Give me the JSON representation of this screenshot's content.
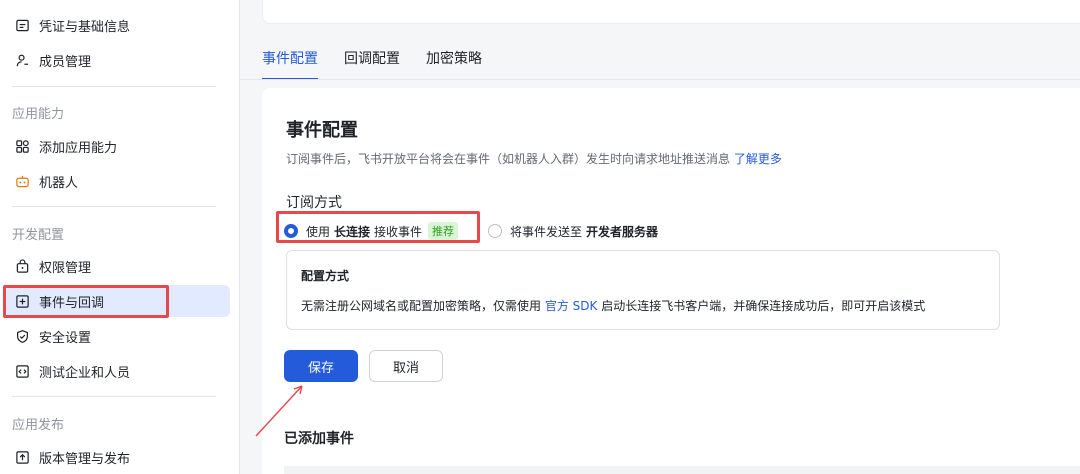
{
  "sidebar": {
    "items": [
      {
        "label": "凭证与基础信息",
        "icon": "credential-icon"
      },
      {
        "label": "成员管理",
        "icon": "member-icon"
      },
      {
        "label": "添加应用能力",
        "icon": "app-grid-icon"
      },
      {
        "label": "机器人",
        "icon": "robot-icon"
      },
      {
        "label": "权限管理",
        "icon": "permission-icon"
      },
      {
        "label": "事件与回调",
        "icon": "event-icon"
      },
      {
        "label": "安全设置",
        "icon": "shield-icon"
      },
      {
        "label": "测试企业和人员",
        "icon": "code-icon"
      },
      {
        "label": "版本管理与发布",
        "icon": "upload-icon"
      }
    ],
    "sections": [
      "应用能力",
      "开发配置",
      "应用发布"
    ]
  },
  "tabs": [
    "事件配置",
    "回调配置",
    "加密策略"
  ],
  "card": {
    "title": "事件配置",
    "desc": "订阅事件后，飞书开放平台将会在事件（如机器人入群）发生时向请求地址推送消息",
    "desc_link": "了解更多",
    "subscribe_title": "订阅方式",
    "option1_pre": "使用",
    "option1_strong": "长连接",
    "option1_post": "接收事件",
    "option1_badge": "推荐",
    "option2_pre": "将事件发送至",
    "option2_strong": "开发者服务器",
    "info_title": "配置方式",
    "info_pre": "无需注册公网域名或配置加密策略，仅需使用",
    "info_link": "官方 SDK",
    "info_post": "启动长连接飞书客户端，并确保连接成功后，即可开启该模式",
    "save_label": "保存",
    "cancel_label": "取消",
    "added_title": "已添加事件"
  },
  "colors": {
    "accent": "#245bdb",
    "highlight_red": "#e8474c",
    "badge_green": "#2ea121"
  }
}
